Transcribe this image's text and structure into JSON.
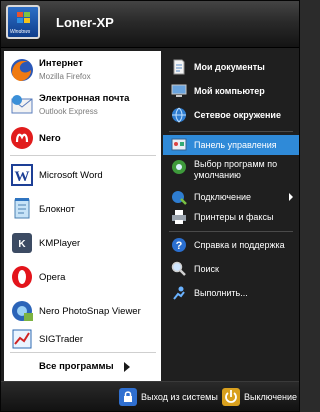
{
  "header": {
    "username": "Loner-XP",
    "avatar_caption": "Windows"
  },
  "left": {
    "pinned": [
      {
        "title": "Интернет",
        "subtitle": "Mozilla Firefox",
        "icon": "firefox-icon"
      },
      {
        "title": "Электронная почта",
        "subtitle": "Outlook Express",
        "icon": "outlook-express-icon"
      },
      {
        "title": "Nero",
        "icon": "nero-icon"
      }
    ],
    "recent": [
      {
        "title": "Microsoft Word",
        "icon": "word-icon"
      },
      {
        "title": "Блокнот",
        "icon": "notepad-icon"
      },
      {
        "title": "KMPlayer",
        "icon": "kmplayer-icon"
      },
      {
        "title": "Opera",
        "icon": "opera-icon"
      },
      {
        "title": "Nero PhotoSnap Viewer",
        "icon": "photosnap-icon"
      },
      {
        "title": "SIGTrader",
        "icon": "sigtrader-icon"
      }
    ],
    "all_programs": "Все программы"
  },
  "right": {
    "items": [
      {
        "label": "Мои документы",
        "icon": "documents-icon"
      },
      {
        "label": "Мой компьютер",
        "icon": "computer-icon"
      },
      {
        "label": "Сетевое окружение",
        "icon": "network-icon"
      },
      {
        "label": "Панель управления",
        "icon": "control-panel-icon"
      },
      {
        "label": "Выбор программ по умолчанию",
        "icon": "default-programs-icon"
      },
      {
        "label": "Подключение",
        "icon": "connect-icon"
      },
      {
        "label": "Принтеры и факсы",
        "icon": "printer-icon"
      },
      {
        "label": "Справка и поддержка",
        "icon": "help-icon"
      },
      {
        "label": "Поиск",
        "icon": "search-icon"
      },
      {
        "label": "Выполнить...",
        "icon": "run-icon"
      }
    ]
  },
  "footer": {
    "logoff": "Выход из системы",
    "shutdown": "Выключение"
  },
  "colors": {
    "highlight": "#2f8ad8",
    "panel_dark": "#1f1f1f",
    "left_bg": "#ffffff"
  }
}
